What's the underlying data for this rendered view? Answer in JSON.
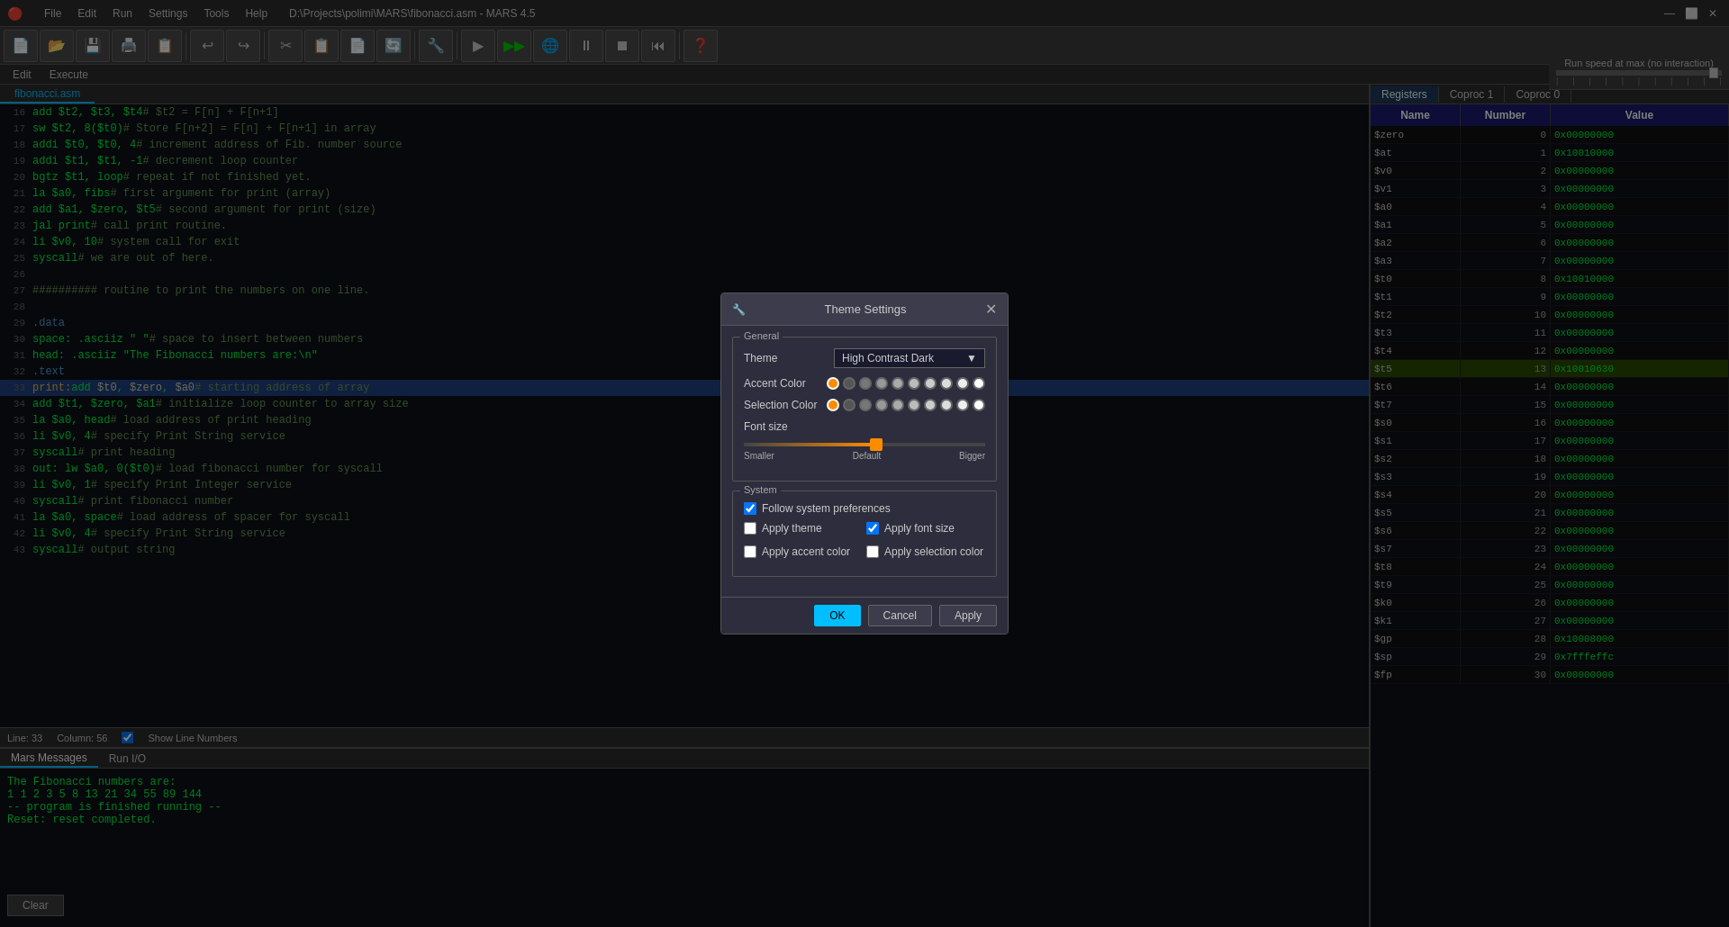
{
  "titlebar": {
    "icon": "🔴",
    "menu": [
      "File",
      "Edit",
      "Run",
      "Settings",
      "Tools",
      "Help"
    ],
    "title": "D:\\Projects\\polimi\\MARS\\fibonacci.asm - MARS 4.5",
    "controls": [
      "—",
      "⬜",
      "✕"
    ]
  },
  "speedbar": {
    "label": "Run speed at max (no interaction)"
  },
  "toolbar": {
    "buttons": [
      "📄",
      "📂",
      "💾",
      "🖨️",
      "📋",
      "↩",
      "↪",
      "✂",
      "📋",
      "📄",
      "🔄",
      "🔧",
      "▶",
      "▶▶",
      "🌐",
      "⏸",
      "⏹",
      "⏮",
      "❓"
    ]
  },
  "menubar": {
    "items": [
      "Edit",
      "Execute"
    ]
  },
  "editor": {
    "tab": "fibonacci.asm",
    "lines": [
      {
        "num": "16",
        "code": "    add  $t2, $t3, $t4",
        "comment": "# $t2 = F[n] + F[n+1]",
        "type": "normal"
      },
      {
        "num": "17",
        "code": "    sw   $t2, 8($t0)",
        "comment": "# Store F[n+2] = F[n] + F[n+1] in array",
        "type": "normal"
      },
      {
        "num": "18",
        "code": "    addi $t0, $t0, 4",
        "comment": "# increment address of Fib. number source",
        "type": "normal"
      },
      {
        "num": "19",
        "code": "    addi $t1, $t1, -1",
        "comment": "# decrement loop counter",
        "type": "normal"
      },
      {
        "num": "20",
        "code": "    bgtz $t1, loop",
        "comment": "# repeat if not finished yet.",
        "type": "normal"
      },
      {
        "num": "21",
        "code": "    la   $a0, fibs",
        "comment": "# first argument for print (array)",
        "type": "normal"
      },
      {
        "num": "22",
        "code": "    add  $a1, $zero, $t5",
        "comment": "# second argument for print (size)",
        "type": "normal"
      },
      {
        "num": "23",
        "code": "    jal  print",
        "comment": "# call print routine.",
        "type": "normal"
      },
      {
        "num": "24",
        "code": "    li   $v0, 10",
        "comment": "# system call for exit",
        "type": "normal"
      },
      {
        "num": "25",
        "code": "    syscall",
        "comment": "# we are out of here.",
        "type": "normal"
      },
      {
        "num": "26",
        "code": "",
        "comment": "",
        "type": "normal"
      },
      {
        "num": "27",
        "code": "##########  routine to print the numbers on one line.",
        "comment": "",
        "type": "comment"
      },
      {
        "num": "28",
        "code": "",
        "comment": "",
        "type": "normal"
      },
      {
        "num": "29",
        "code": "    .data",
        "comment": "",
        "type": "directive"
      },
      {
        "num": "30",
        "code": "space: .asciiz \" \"",
        "comment": "# space to insert between numbers",
        "type": "normal"
      },
      {
        "num": "31",
        "code": "head:  .asciiz \"The Fibonacci numbers are:\\n\"",
        "comment": "",
        "type": "normal"
      },
      {
        "num": "32",
        "code": "    .text",
        "comment": "",
        "type": "directive"
      },
      {
        "num": "33",
        "code": "print:add  $t0, $zero, $a0",
        "comment": "# starting address of array",
        "type": "selected"
      },
      {
        "num": "34",
        "code": "    add  $t1, $zero, $a1",
        "comment": "# initialize loop counter to array size",
        "type": "normal"
      },
      {
        "num": "35",
        "code": "    la   $a0, head",
        "comment": "# load address of print heading",
        "type": "normal"
      },
      {
        "num": "36",
        "code": "    li   $v0, 4",
        "comment": "# specify Print String service",
        "type": "normal"
      },
      {
        "num": "37",
        "code": "    syscall",
        "comment": "# print heading",
        "type": "normal"
      },
      {
        "num": "38",
        "code": "out:  lw   $a0, 0($t0)",
        "comment": "# load fibonacci number for syscall",
        "type": "normal"
      },
      {
        "num": "39",
        "code": "    li   $v0, 1",
        "comment": "# specify Print Integer service",
        "type": "normal"
      },
      {
        "num": "40",
        "code": "    syscall",
        "comment": "# print fibonacci number",
        "type": "normal"
      },
      {
        "num": "41",
        "code": "    la   $a0, space",
        "comment": "# load address of spacer for syscall",
        "type": "normal"
      },
      {
        "num": "42",
        "code": "    li   $v0, 4",
        "comment": "# specify Print String service",
        "type": "normal"
      },
      {
        "num": "43",
        "code": "    syscall",
        "comment": "# output string",
        "type": "normal"
      }
    ]
  },
  "statusbar": {
    "line": "Line: 33",
    "column": "Column: 56",
    "show_line_numbers": "Show Line Numbers"
  },
  "bottom_panel": {
    "tabs": [
      "Mars Messages",
      "Run I/O"
    ],
    "active_tab": "Mars Messages",
    "messages": [
      "The Fibonacci numbers are:",
      "  1 1 2 3 5 8 13 21 34 55 89 144",
      "  -- program is finished running --",
      "",
      "Reset: reset completed."
    ],
    "clear_btn": "Clear"
  },
  "registers": {
    "tabs": [
      "Registers",
      "Coproc 1",
      "Coproc 0"
    ],
    "active_tab": "Registers",
    "headers": [
      "Name",
      "Number",
      "Value"
    ],
    "rows": [
      {
        "name": "$zero",
        "number": "0",
        "value": "0x00000000",
        "highlight": false
      },
      {
        "name": "$at",
        "number": "1",
        "value": "0x10010000",
        "highlight": false
      },
      {
        "name": "$v0",
        "number": "2",
        "value": "0x00000000",
        "highlight": false
      },
      {
        "name": "$v1",
        "number": "3",
        "value": "0x00000000",
        "highlight": false
      },
      {
        "name": "$a0",
        "number": "4",
        "value": "0x00000000",
        "highlight": false
      },
      {
        "name": "$a1",
        "number": "5",
        "value": "0x00000000",
        "highlight": false
      },
      {
        "name": "$a2",
        "number": "6",
        "value": "0x00000000",
        "highlight": false
      },
      {
        "name": "$a3",
        "number": "7",
        "value": "0x00000000",
        "highlight": false
      },
      {
        "name": "$t0",
        "number": "8",
        "value": "0x10010000",
        "highlight": false
      },
      {
        "name": "$t1",
        "number": "9",
        "value": "0x00000000",
        "highlight": false
      },
      {
        "name": "$t2",
        "number": "10",
        "value": "0x00000000",
        "highlight": false
      },
      {
        "name": "$t3",
        "number": "11",
        "value": "0x00000000",
        "highlight": false
      },
      {
        "name": "$t4",
        "number": "12",
        "value": "0x00000000",
        "highlight": false
      },
      {
        "name": "$t5",
        "number": "13",
        "value": "0x10010630",
        "highlight": true
      },
      {
        "name": "$t6",
        "number": "14",
        "value": "0x00000000",
        "highlight": false
      },
      {
        "name": "$t7",
        "number": "15",
        "value": "0x00000000",
        "highlight": false
      },
      {
        "name": "$s0",
        "number": "16",
        "value": "0x00000000",
        "highlight": false
      },
      {
        "name": "$s1",
        "number": "17",
        "value": "0x00000000",
        "highlight": false
      },
      {
        "name": "$s2",
        "number": "18",
        "value": "0x00000000",
        "highlight": false
      },
      {
        "name": "$s3",
        "number": "19",
        "value": "0x00000000",
        "highlight": false
      },
      {
        "name": "$s4",
        "number": "20",
        "value": "0x00000000",
        "highlight": false
      },
      {
        "name": "$s5",
        "number": "21",
        "value": "0x00000000",
        "highlight": false
      },
      {
        "name": "$s6",
        "number": "22",
        "value": "0x00000000",
        "highlight": false
      },
      {
        "name": "$s7",
        "number": "23",
        "value": "0x00000000",
        "highlight": false
      },
      {
        "name": "$t8",
        "number": "24",
        "value": "0x00000000",
        "highlight": false
      },
      {
        "name": "$t9",
        "number": "25",
        "value": "0x00000000",
        "highlight": false
      },
      {
        "name": "$k0",
        "number": "26",
        "value": "0x00000000",
        "highlight": false
      },
      {
        "name": "$k1",
        "number": "27",
        "value": "0x00000000",
        "highlight": false
      },
      {
        "name": "$gp",
        "number": "28",
        "value": "0x10008000",
        "highlight": false
      },
      {
        "name": "$sp",
        "number": "29",
        "value": "0x7fffeffc",
        "highlight": false
      },
      {
        "name": "$fp",
        "number": "30",
        "value": "0x00000000",
        "highlight": false
      }
    ]
  },
  "modal": {
    "title": "Theme Settings",
    "sections": {
      "general": {
        "label": "General",
        "theme_label": "Theme",
        "theme_value": "High Contrast Dark",
        "accent_label": "Accent Color",
        "selection_label": "Selection Color",
        "font_label": "Font size",
        "font_labels": [
          "Smaller",
          "Default",
          "Bigger"
        ]
      },
      "system": {
        "label": "System",
        "checkboxes": [
          {
            "id": "follow_sys",
            "label": "Follow system preferences",
            "checked": true
          },
          {
            "id": "apply_theme",
            "label": "Apply theme",
            "checked": false
          },
          {
            "id": "apply_font",
            "label": "Apply font size",
            "checked": true
          },
          {
            "id": "apply_accent",
            "label": "Apply accent color",
            "checked": false
          },
          {
            "id": "apply_selection",
            "label": "Apply selection color",
            "checked": false
          }
        ]
      }
    },
    "buttons": {
      "ok": "OK",
      "cancel": "Cancel",
      "apply": "Apply"
    }
  }
}
